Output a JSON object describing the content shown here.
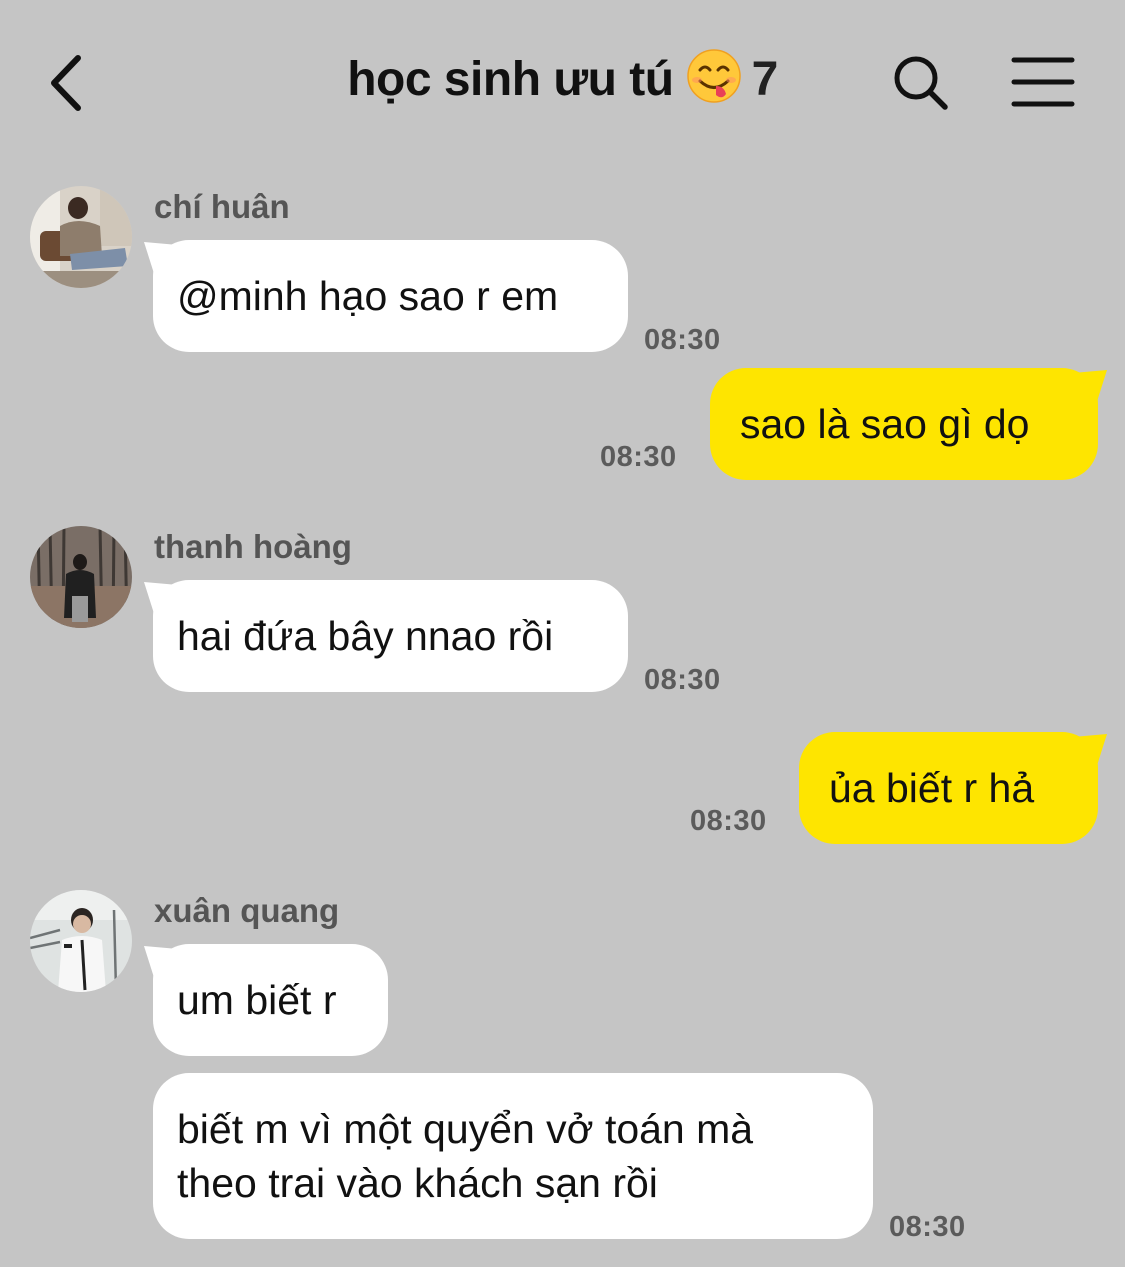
{
  "header": {
    "title": "học sinh ưu tú",
    "emoji": "face-savoring-food-emoji",
    "member_count": "7",
    "back_icon": "chevron-left-icon",
    "search_icon": "search-icon",
    "menu_icon": "menu-icon"
  },
  "colors": {
    "background": "#c5c5c5",
    "incoming_bubble": "#ffffff",
    "outgoing_bubble": "#fee500"
  },
  "messages": [
    {
      "direction": "in",
      "sender": "chí huân",
      "text": "@minh hạo sao r em",
      "time": "08:30"
    },
    {
      "direction": "out",
      "text": "sao là sao gì dọ",
      "time": "08:30"
    },
    {
      "direction": "in",
      "sender": "thanh hoàng",
      "text": "hai đứa bây nnao rồi",
      "time": "08:30"
    },
    {
      "direction": "out",
      "text": "ủa biết r hả",
      "time": "08:30"
    },
    {
      "direction": "in",
      "sender": "xuân quang",
      "text": "um biết r",
      "time": ""
    },
    {
      "direction": "in",
      "text_lines": [
        "biết m vì một quyển vở toán mà",
        "theo trai vào khách sạn rồi"
      ],
      "time": "08:30"
    }
  ]
}
